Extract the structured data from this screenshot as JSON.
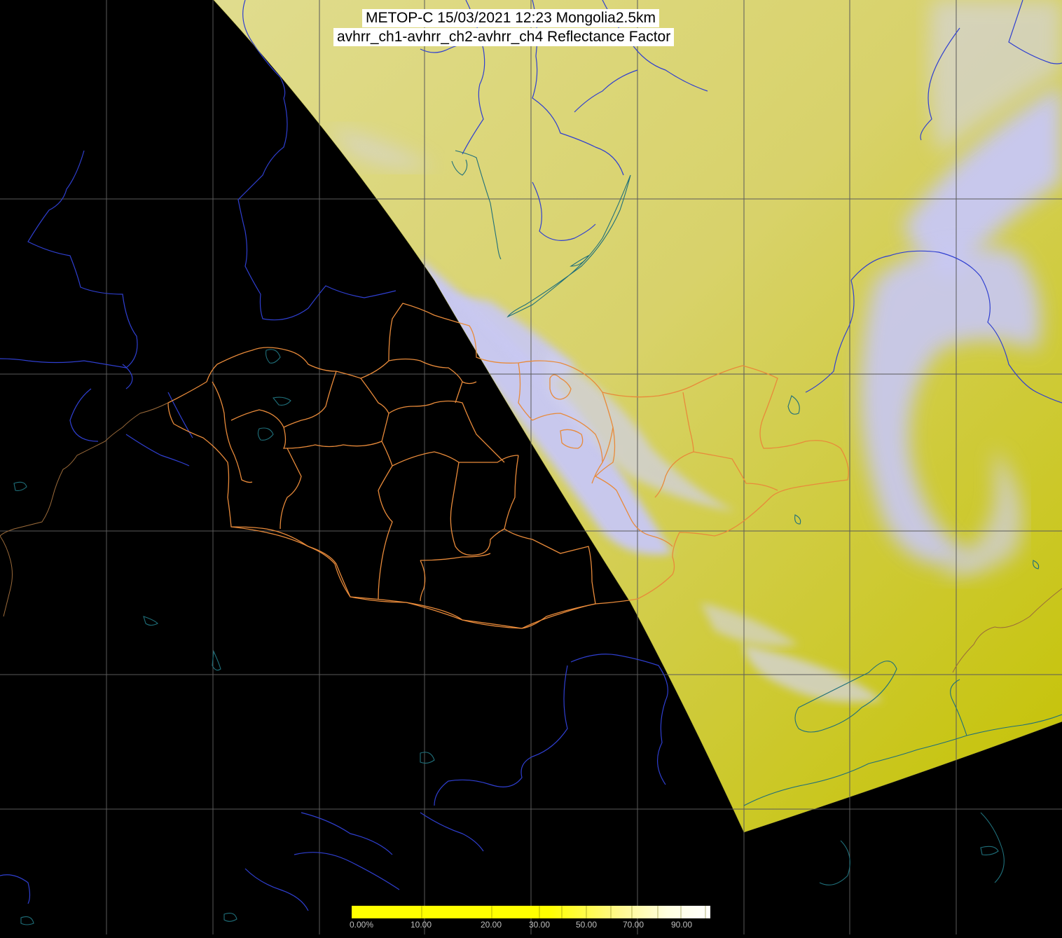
{
  "title": {
    "line1": "METOP-C 15/03/2021 12:23 Mongolia2.5km",
    "line2": "avhrr_ch1-avhrr_ch2-avhrr_ch4 Reflectance Factor"
  },
  "colors": {
    "background": "#000000",
    "swath_yellow": "#c9c800",
    "swath_light_yellow": "#d6d27a",
    "cloud_lavender": "#c8c8f5",
    "grid": "#5a5a5a",
    "rivers": "#2f3fd0",
    "coast_lakes": "#1f6f7a",
    "mongolia_borders": "#e88a3a",
    "colorbar_yellow": "#ffff00"
  },
  "colorbar": {
    "labels": [
      "0.00%",
      "10.00",
      "20.00",
      "30.00",
      "50.00",
      "70.00",
      "90.00"
    ]
  }
}
